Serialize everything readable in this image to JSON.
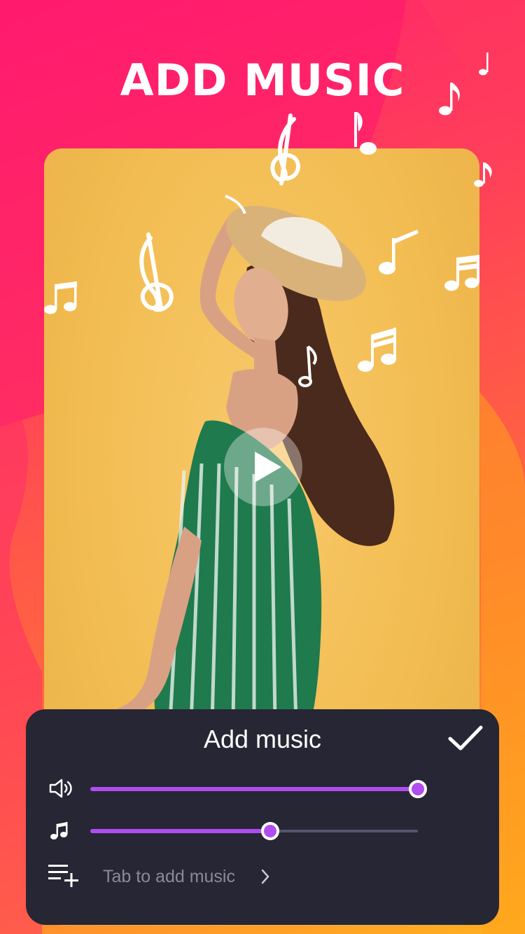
{
  "promo": {
    "title": "ADD MUSIC"
  },
  "colors": {
    "accent": "#b04cf0",
    "panel_bg": "#262634",
    "backdrop": "#f2bd52"
  },
  "preview": {
    "play_icon": "play-icon"
  },
  "panel": {
    "title": "Add music",
    "confirm_icon": "check-icon",
    "original_volume": {
      "icon": "speaker-icon",
      "level": 1.0
    },
    "music_volume": {
      "icon": "music-note-icon",
      "level": 0.55
    },
    "add_music": {
      "icon": "playlist-add-icon",
      "label": "Tab to add music",
      "chevron": "chevron-right-icon"
    }
  }
}
